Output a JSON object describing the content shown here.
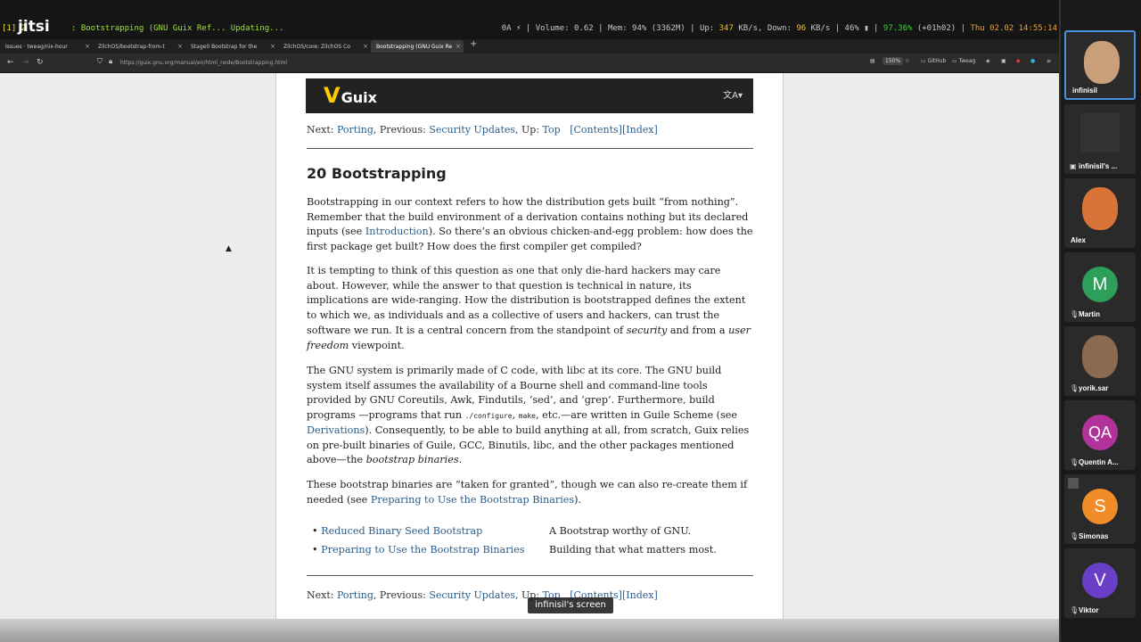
{
  "status_bar": {
    "workspace": "[1] 2",
    "window_title": ": Bootstrapping (GNU Guix Ref... Updating...",
    "power": "0A ⚡ |",
    "volume": "Volume: 0.62 |",
    "memory": "Mem: 94% (3362M) |",
    "upload_label": "Up:",
    "upload_value": "347",
    "upload_unit": "KB/s,",
    "download_label": "Down:",
    "download_value": "96",
    "download_unit": "KB/s |",
    "brightness": "46% ▮ |",
    "battery": "97.36%",
    "battery_time": "(+01h02) |",
    "clock": "Thu 02.02 14:55:14"
  },
  "jitsi_logo": "jitsi",
  "tabs": [
    {
      "label": "Issues · tweag/nix-hour",
      "active": false
    },
    {
      "label": "ZilchOS/bootstrap-from-t",
      "active": false
    },
    {
      "label": "Stage0 Bootstrap for the",
      "active": false
    },
    {
      "label": "ZilchOS/core: ZilchOS Co",
      "active": false
    },
    {
      "label": "Bootstrapping (GNU Guix Re",
      "active": true
    }
  ],
  "tab_close_glyph": "×",
  "tab_new_glyph": "+",
  "nav": {
    "url": "https://guix.gnu.org/manual/en/html_node/Bootstrapping.html",
    "zoom": "150%",
    "bookmark_github": "GitHub",
    "bookmark_tweag": "Tweag"
  },
  "page": {
    "logo_word": "Guix",
    "lang_icon": "文A▾",
    "nav_top": {
      "next_label": "Next: ",
      "next_link": "Porting",
      "prev_label": ", Previous: ",
      "prev_link": "Security Updates",
      "up_label": ", Up: ",
      "up_link": "Top",
      "contents": "[Contents]",
      "index": "[Index]"
    },
    "chapter_title": "20 Bootstrapping",
    "p1": {
      "a": "Bootstrapping in our context refers to how the distribution gets built “from nothing”. Remember that the build environment of a derivation contains nothing but its declared inputs (see ",
      "link": "Introduction",
      "b": "). So there’s an obvious chicken-and-egg problem: how does the first package get built? How does the first compiler get compiled?"
    },
    "p2": {
      "a": "It is tempting to think of this question as one that only die-hard hackers may care about. However, while the answer to that question is technical in nature, its implications are wide-ranging. How the distribution is bootstrapped defines the extent to which we, as individuals and as a collective of users and hackers, can trust the software we run. It is a central concern from the standpoint of ",
      "em1": "security",
      "b": " and from a ",
      "em2": "user freedom",
      "c": " viewpoint."
    },
    "p3": {
      "a": "The GNU system is primarily made of C code, with libc at its core. The GNU build system itself assumes the availability of a Bourne shell and command-line tools provided by GNU Coreutils, Awk, Findutils, ‘sed’, and ‘grep’. Furthermore, build programs —programs that run ",
      "code1": "./configure",
      "sep": ", ",
      "code2": "make",
      "b": ", etc.—are written in Guile Scheme (see ",
      "link": "Derivations",
      "c": "). Consequently, to be able to build anything at all, from scratch, Guix relies on pre-built binaries of Guile, GCC, Binutils, libc, and the other packages mentioned above—the ",
      "em": "bootstrap binaries",
      "d": "."
    },
    "p4": {
      "a": "These bootstrap binaries are “taken for granted”, though we can also re-create them if needed (see ",
      "link": "Preparing to Use the Bootstrap Binaries",
      "b": ")."
    },
    "bullet": "•",
    "menu": [
      {
        "link": "Reduced Binary Seed Bootstrap",
        "desc": "A Bootstrap worthy of GNU."
      },
      {
        "link": "Preparing to Use the Bootstrap Binaries",
        "desc": "Building that what matters most."
      }
    ],
    "nav_bottom": {
      "next_label": "Next: ",
      "next_link": "Porting",
      "prev_label": ", Previous: ",
      "prev_link": "Security Updates",
      "up_label": ", Up: ",
      "up_link": "Top",
      "contents": "[Contents]",
      "index": "[Index]"
    }
  },
  "screen_label": "infinisil's screen",
  "participants": [
    {
      "name": "infinisil",
      "type": "video",
      "color": "#c9a07a"
    },
    {
      "name": "infinisil's ...",
      "type": "screen",
      "color": "#333333"
    },
    {
      "name": "Alex",
      "type": "video",
      "color": "#d9733a"
    },
    {
      "name": "Martin",
      "initials": "M",
      "type": "avatar",
      "color": "#2e9e5b"
    },
    {
      "name": "yorik.sar",
      "type": "video",
      "color": "#8a6a50"
    },
    {
      "name": "Quentin A...",
      "initials": "QA",
      "type": "avatar",
      "color": "#b0329a"
    },
    {
      "name": "Simonas",
      "initials": "S",
      "type": "avatar",
      "color": "#f28c28"
    },
    {
      "name": "Viktor",
      "initials": "V",
      "type": "avatar",
      "color": "#6a3fc8"
    }
  ],
  "colors": {
    "link": "#2a5e8c",
    "guix_yellow": "#ffcc00",
    "active_speaker_border": "#4a8fe0"
  }
}
